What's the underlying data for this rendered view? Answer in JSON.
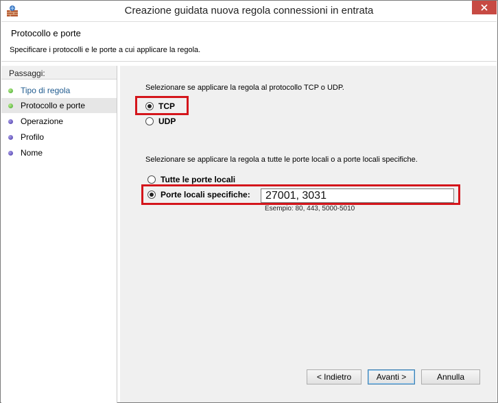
{
  "window": {
    "title": "Creazione guidata nuova regola connessioni in entrata"
  },
  "header": {
    "title": "Protocollo e porte",
    "description": "Specificare i protocolli e le porte a cui applicare la regola."
  },
  "sidebar": {
    "heading": "Passaggi:",
    "steps": [
      {
        "label": "Tipo di regola",
        "status": "completed",
        "dot_color": "#3ea52a"
      },
      {
        "label": "Protocollo e porte",
        "status": "current",
        "dot_color": "#3ea52a"
      },
      {
        "label": "Operazione",
        "status": "pending",
        "dot_color": "#4533a8"
      },
      {
        "label": "Profilo",
        "status": "pending",
        "dot_color": "#4533a8"
      },
      {
        "label": "Nome",
        "status": "pending",
        "dot_color": "#4533a8"
      }
    ]
  },
  "protocol": {
    "prompt": "Selezionare se applicare la regola al protocollo TCP o UDP.",
    "options": [
      {
        "label": "TCP",
        "selected": true
      },
      {
        "label": "UDP",
        "selected": false
      }
    ]
  },
  "ports": {
    "prompt": "Selezionare se applicare la regola a tutte le porte locali o a porte locali specifiche.",
    "all_label": "Tutte le porte locali",
    "all_selected": false,
    "specific_label": "Porte locali specifiche:",
    "specific_selected": true,
    "value": "27001, 3031",
    "example": "Esempio: 80, 443, 5000-5010"
  },
  "buttons": {
    "back": "< Indietro",
    "next": "Avanti >",
    "cancel": "Annulla"
  },
  "highlight_color": "#d4151b"
}
